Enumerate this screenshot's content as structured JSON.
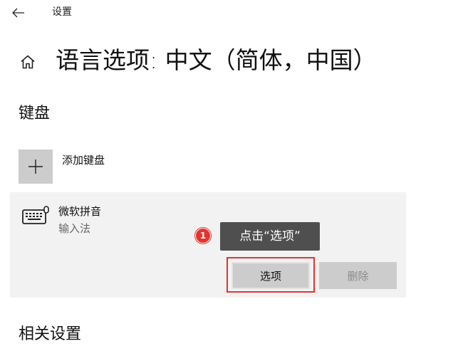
{
  "titlebar": {
    "back_icon": "back-arrow-icon",
    "title": "设置"
  },
  "page": {
    "home_icon": "home-icon",
    "title": "语言选项: 中文（简体，中国）"
  },
  "keyboard_section": {
    "title": "键盘",
    "add_keyboard": {
      "icon": "plus-icon",
      "label": "添加键盘"
    },
    "keyboard": {
      "icon": "keyboard-icon",
      "name": "微软拼音",
      "type": "输入法",
      "options_label": "选项",
      "delete_label": "删除"
    }
  },
  "annotation": {
    "step": "1",
    "text": "点击“选项”"
  },
  "related_section": {
    "title": "相关设置"
  },
  "colors": {
    "highlight": "#e0342f",
    "button_bg": "#cccccc",
    "panel_bg": "#f2f2f2",
    "tooltip_bg": "#4f4f4f"
  }
}
